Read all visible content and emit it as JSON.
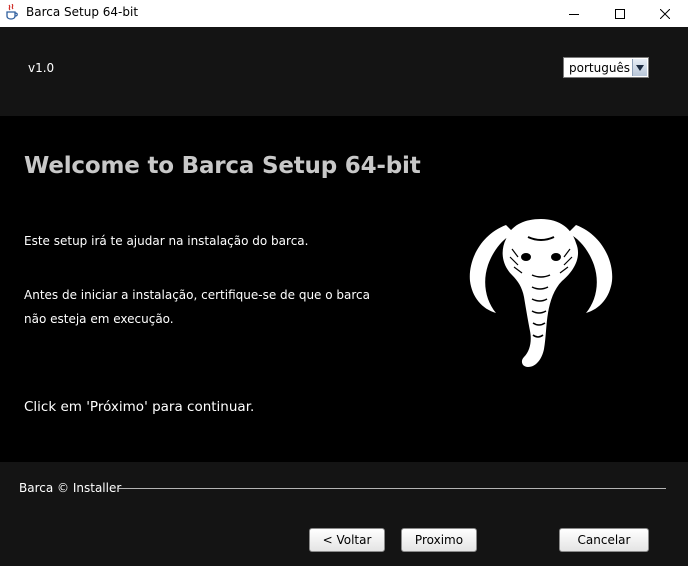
{
  "window": {
    "title": "Barca Setup 64-bit"
  },
  "header": {
    "version": "v1.0",
    "language": "português"
  },
  "main": {
    "heading": "Welcome to Barca Setup 64-bit",
    "para1": "Este setup irá te ajudar na instalação do barca.",
    "para2_line1": "Antes de iniciar a instalação, certifique-se de que o barca",
    "para2_line2": "não esteja em execução.",
    "continue": "Click em 'Próximo' para continuar."
  },
  "footer": {
    "label": "Barca © Installer",
    "back": "< Voltar",
    "next": "Proximo",
    "cancel": "Cancelar"
  },
  "icons": {
    "app": "java-cup-icon",
    "minimize": "minimize-icon",
    "maximize": "maximize-icon",
    "close": "close-icon",
    "dropdown": "chevron-down-icon",
    "logo": "mammoth-logo"
  },
  "colors": {
    "main_bg": "#000000",
    "panel_bg": "#141414",
    "heading": "#c8c8c8",
    "text": "#ffffff"
  }
}
